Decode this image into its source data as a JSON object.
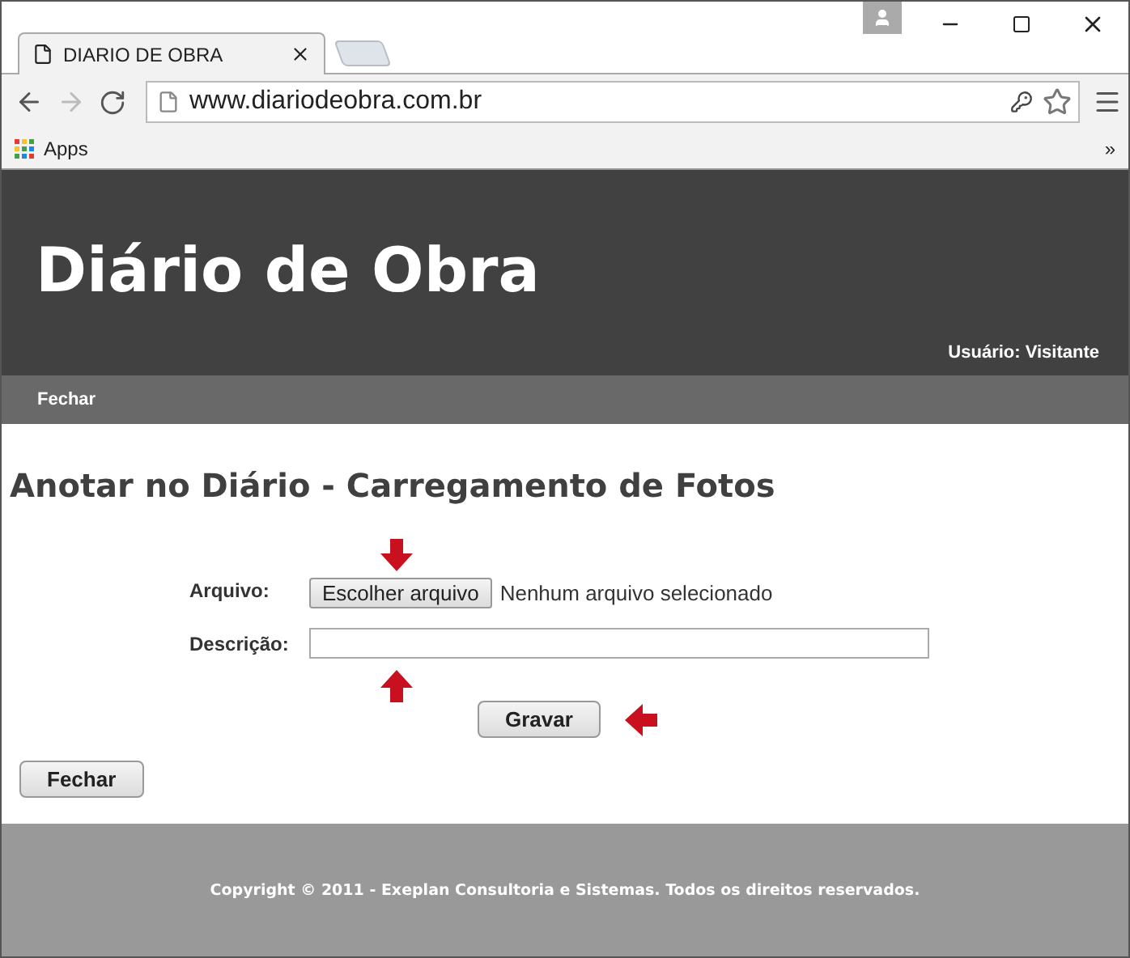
{
  "browser": {
    "tab_title": "DIARIO DE OBRA",
    "url": "www.diariodeobra.com.br",
    "bookmarks": [
      "Apps"
    ],
    "overflow": "»"
  },
  "header": {
    "title": "Diário de Obra",
    "user": "Usuário: Visitante"
  },
  "nav": [
    "Fechar"
  ],
  "page_title": "Anotar no Diário - Carregamento de Fotos",
  "form": {
    "file_label": "Arquivo:",
    "file_button": "Escolher arquivo",
    "file_status": "Nenhum arquivo selecionado",
    "description_label": "Descrição:",
    "submit": "Gravar"
  },
  "close_button": "Fechar",
  "footer": "Copyright © 2011 - Exeplan Consultoria e Sistemas. Todos os direitos reservados."
}
